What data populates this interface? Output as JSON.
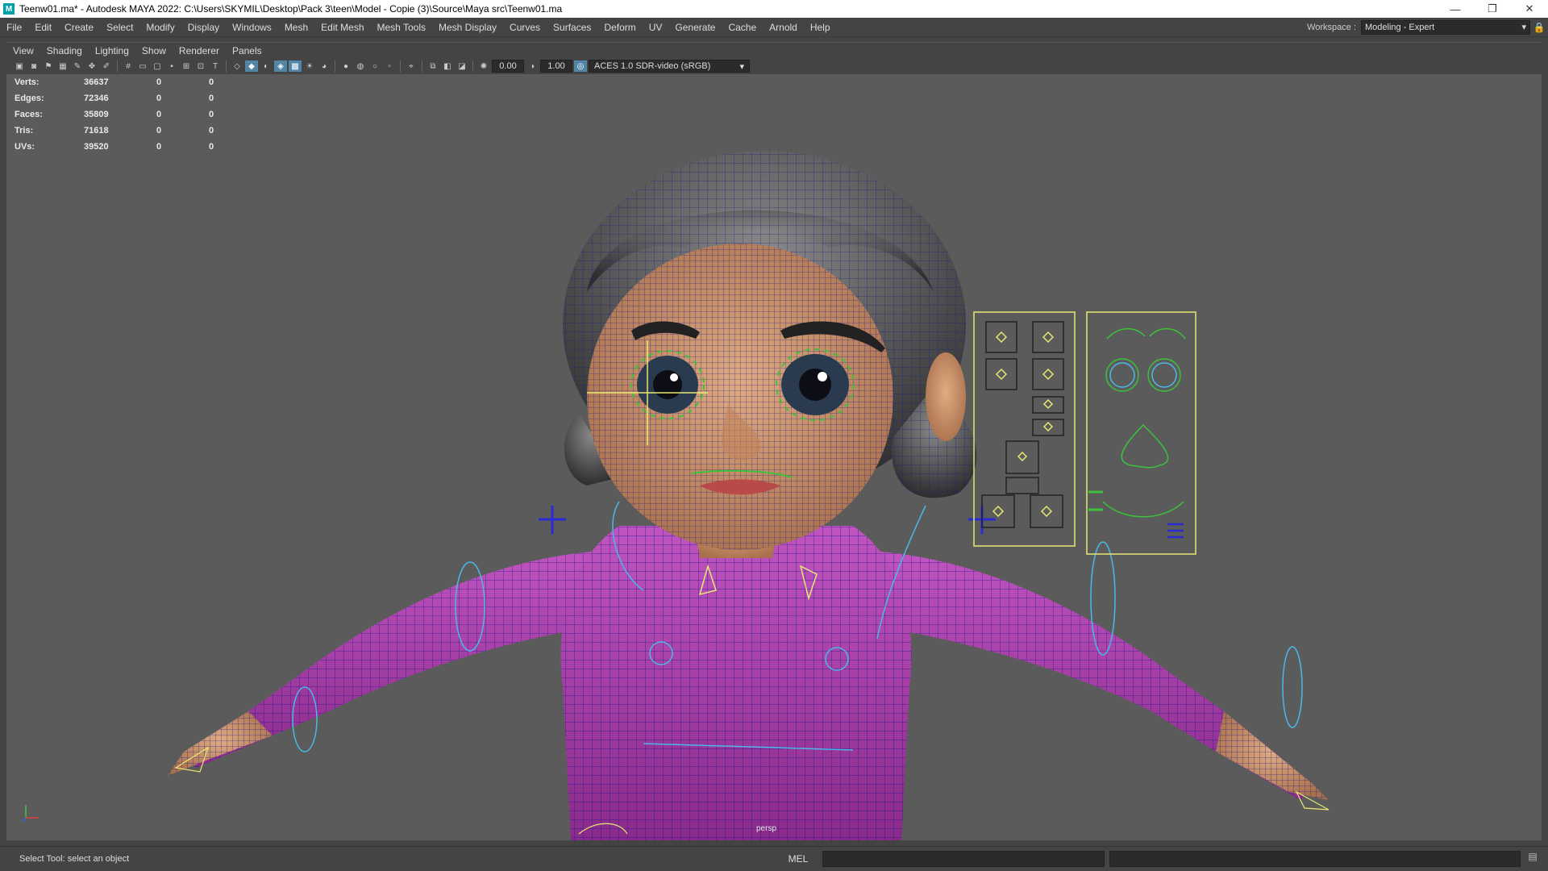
{
  "window": {
    "title": "Teenw01.ma* - Autodesk MAYA 2022: C:\\Users\\SKYMIL\\Desktop\\Pack 3\\teen\\Model - Copie (3)\\Source\\Maya src\\Teenw01.ma",
    "app_icon": "M",
    "minimize": "—",
    "maximize": "❐",
    "close": "✕"
  },
  "menubar": {
    "items": [
      "File",
      "Edit",
      "Create",
      "Select",
      "Modify",
      "Display",
      "Windows",
      "Mesh",
      "Edit Mesh",
      "Mesh Tools",
      "Mesh Display",
      "Curves",
      "Surfaces",
      "Deform",
      "UV",
      "Generate",
      "Cache",
      "Arnold",
      "Help"
    ],
    "workspace_label": "Workspace :",
    "workspace_value": "Modeling - Expert"
  },
  "panel_menu": [
    "View",
    "Shading",
    "Lighting",
    "Show",
    "Renderer",
    "Panels"
  ],
  "toolbar": {
    "field_a": "0.00",
    "field_b": "1.00",
    "color_mgmt": "ACES 1.0 SDR-video (sRGB)"
  },
  "hud": {
    "rows": [
      {
        "label": "Verts:",
        "value": "36637",
        "sel": "0",
        "comp": "0"
      },
      {
        "label": "Edges:",
        "value": "72346",
        "sel": "0",
        "comp": "0"
      },
      {
        "label": "Faces:",
        "value": "35809",
        "sel": "0",
        "comp": "0"
      },
      {
        "label": "Tris:",
        "value": "71618",
        "sel": "0",
        "comp": "0"
      },
      {
        "label": "UVs:",
        "value": "39520",
        "sel": "0",
        "comp": "0"
      }
    ]
  },
  "viewport": {
    "camera_label": "persp",
    "colors": {
      "background": "#5b5b5b",
      "wire": "#1a1a8c",
      "skin": "#c89670",
      "shirt": "#b83fb8",
      "hair": "#555555",
      "control": "#e8e870"
    }
  },
  "statusbar": {
    "help_text": "Select Tool: select an object",
    "mel_label": "MEL"
  }
}
